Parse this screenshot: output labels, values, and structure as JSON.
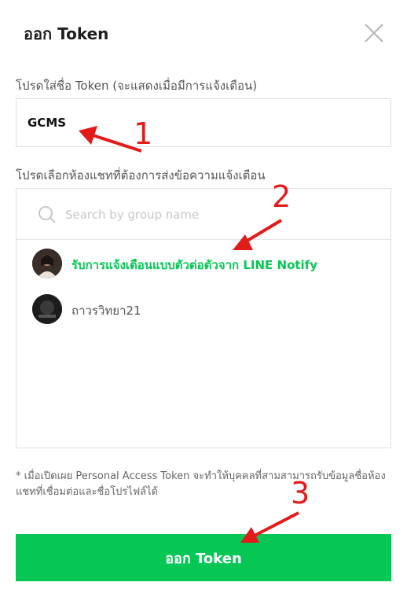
{
  "dialog": {
    "title": "ออก Token",
    "close_icon": "close-icon"
  },
  "token_name": {
    "label": "โปรดใส่ชื่อ Token (จะแสดงเมื่อมีการแจ้งเตือน)",
    "value": "GCMS"
  },
  "group_select": {
    "label": "โปรดเลือกห้องแชทที่ต้องการส่งข้อความแจ้งเตือน",
    "search_placeholder": "Search by group name",
    "items": [
      {
        "name": "รับการแจ้งเตือนแบบตัวต่อตัวจาก LINE Notify",
        "selected": true
      },
      {
        "name": "ถาวรวิทยา21",
        "selected": false
      }
    ]
  },
  "note": "* เมื่อเปิดเผย Personal Access Token จะทำให้บุคคลที่สามสามารถรับข้อมูลชื่อห้องแชทที่เชื่อมต่อและชื่อโปรไฟล์ได้",
  "submit_label": "ออก Token",
  "annotations": [
    "1",
    "2",
    "3"
  ],
  "colors": {
    "accent": "#06c755",
    "annotation": "#e21b1b"
  }
}
